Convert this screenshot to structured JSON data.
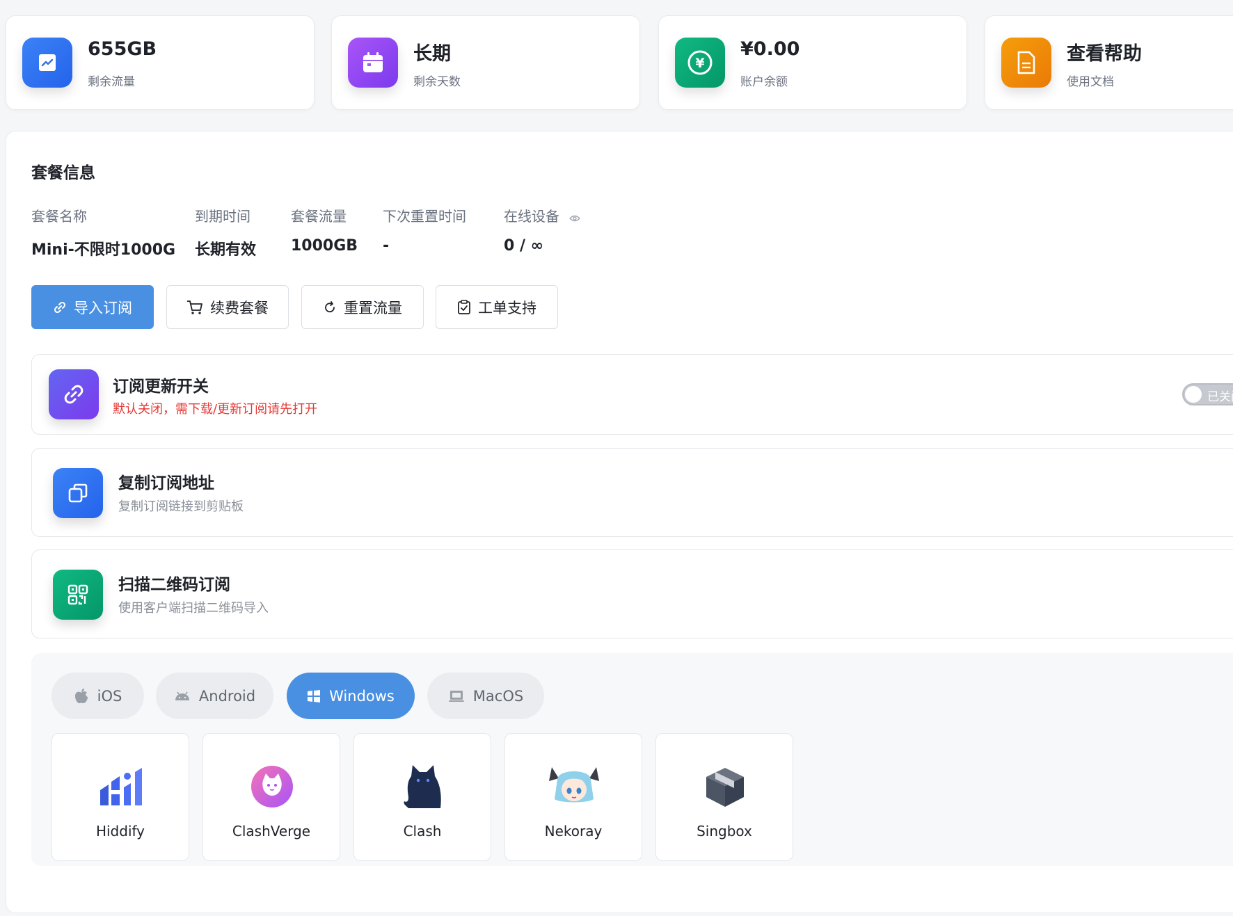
{
  "stats": [
    {
      "value": "655GB",
      "label": "剩余流量",
      "icon": "trend-chart-icon",
      "color": "#3b82f6"
    },
    {
      "value": "长期",
      "label": "剩余天数",
      "icon": "calendar-icon",
      "color": "#8b5cf6"
    },
    {
      "value": "¥0.00",
      "label": "账户余额",
      "icon": "yen-coin-icon",
      "color": "#10b981"
    },
    {
      "value": "查看帮助",
      "label": "使用文档",
      "icon": "document-icon",
      "color": "#f59e0b"
    }
  ],
  "plan": {
    "title": "套餐信息",
    "labels": {
      "name": "套餐名称",
      "expire": "到期时间",
      "traffic": "套餐流量",
      "reset": "下次重置时间",
      "devices": "在线设备"
    },
    "values": {
      "name": "Mini-不限时1000G",
      "expire": "长期有效",
      "traffic": "1000GB",
      "reset": "-",
      "devices": "0 / ∞"
    }
  },
  "actions": {
    "import": "导入订阅",
    "renew": "续费套餐",
    "reset": "重置流量",
    "ticket": "工单支持"
  },
  "features": {
    "update_switch": {
      "title": "订阅更新开关",
      "desc": "默认关闭，需下载/更新订阅请先打开",
      "toggle_label": "已关闭"
    },
    "copy": {
      "title": "复制订阅地址",
      "desc": "复制订阅链接到剪贴板"
    },
    "qr": {
      "title": "扫描二维码订阅",
      "desc": "使用客户端扫描二维码导入"
    }
  },
  "platforms": {
    "tabs": [
      "iOS",
      "Android",
      "Windows",
      "MacOS"
    ],
    "active": "Windows"
  },
  "apps": [
    "Hiddify",
    "ClashVerge",
    "Clash",
    "Nekoray",
    "Singbox"
  ],
  "colors": {
    "accent": "#4a90e2",
    "warning_text": "#e53935"
  }
}
